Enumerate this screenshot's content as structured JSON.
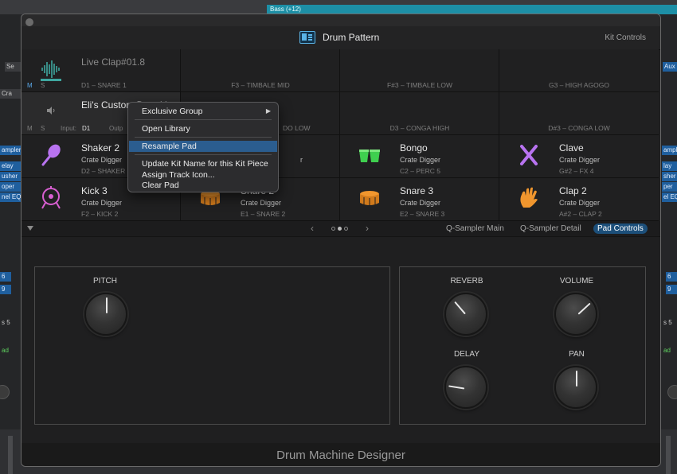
{
  "background": {
    "region_label": "Bass (+12)",
    "left_tags": [
      "Se",
      "Cra",
      "ampler",
      "elay",
      "usher",
      "oper",
      "nel EQ",
      "6",
      "9",
      "s 5",
      "ad"
    ],
    "right_tags": [
      "Aux",
      "ampler",
      "lay",
      "sher",
      "per",
      "el EQ",
      "6",
      "9",
      "s 5",
      "ad"
    ]
  },
  "header": {
    "title": "Drum Pattern",
    "right_label": "Kit Controls",
    "icon": "drum-pattern-icon"
  },
  "pads": [
    {
      "name": "Live Clap#01.8",
      "sub": "",
      "note": "D1 – SNARE 1",
      "icon": "waveform-icon",
      "ms": [
        "M",
        "S"
      ]
    },
    {
      "name": "",
      "sub": "",
      "note": "F3 – TIMBALE MID",
      "icon": ""
    },
    {
      "name": "",
      "sub": "",
      "note": "F#3 – TIMBALE LOW",
      "icon": ""
    },
    {
      "name": "",
      "sub": "",
      "note": "G3 – HIGH AGOGO",
      "icon": ""
    },
    {
      "name": "Eli's Custom Drumkit",
      "sub": "",
      "note": "",
      "icon": "speaker-icon",
      "ms": [
        "M",
        "S",
        "Input:",
        "D1",
        "Outp"
      ]
    },
    {
      "name": "",
      "sub": "",
      "note": "DO LOW",
      "icon": ""
    },
    {
      "name": "",
      "sub": "",
      "note": "D3 – CONGA HIGH",
      "icon": ""
    },
    {
      "name": "",
      "sub": "",
      "note": "D#3 – CONGA LOW",
      "icon": ""
    },
    {
      "name": "Shaker 2",
      "sub": "Crate Digger",
      "note": "D2 – SHAKER",
      "icon": "maraca-icon"
    },
    {
      "name": "",
      "sub": "r",
      "note": "",
      "icon": ""
    },
    {
      "name": "Bongo",
      "sub": "Crate Digger",
      "note": "C2 – PERC 5",
      "icon": "bongo-icon"
    },
    {
      "name": "Clave",
      "sub": "Crate Digger",
      "note": "G#2 – FX 4",
      "icon": "clave-icon"
    },
    {
      "name": "Kick 3",
      "sub": "Crate Digger",
      "note": "F2 – KICK 2",
      "icon": "kick-drum-icon"
    },
    {
      "name": "Snare 2",
      "sub": "Crate Digger",
      "note": "E1 – SNARE 2",
      "icon": "snare-drum-icon"
    },
    {
      "name": "Snare 3",
      "sub": "Crate Digger",
      "note": "E2 – SNARE 3",
      "icon": "snare-drum-icon"
    },
    {
      "name": "Clap 2",
      "sub": "Crate Digger",
      "note": "A#2 – CLAP 2",
      "icon": "clap-hand-icon"
    }
  ],
  "tabs": {
    "items": [
      "Q-Sampler Main",
      "Q-Sampler Detail",
      "Pad Controls"
    ],
    "active": "Pad Controls",
    "page_dots": 3,
    "active_dot": 2
  },
  "knobs": {
    "pitch": {
      "label": "PITCH",
      "value": 0
    },
    "reverb": {
      "label": "REVERB",
      "value": -0.3
    },
    "volume": {
      "label": "VOLUME",
      "value": 0.35
    },
    "delay": {
      "label": "DELAY",
      "value": -0.6
    },
    "pan": {
      "label": "PAN",
      "value": 0
    }
  },
  "footer": {
    "title": "Drum Machine Designer"
  },
  "context_menu": {
    "items": [
      {
        "label": "Exclusive Group",
        "submenu": true
      },
      {
        "label": "Open Library"
      },
      {
        "label": "Resample Pad",
        "highlighted": true
      },
      {
        "label": "Update Kit Name for this Kit Piece"
      },
      {
        "label": "Assign Track Icon..."
      },
      {
        "label": "Clear Pad"
      }
    ]
  },
  "colors": {
    "accent_blue": "#2b5d8f",
    "tab_active": "#1c4f7a",
    "icon_purple": "#b873f0",
    "icon_green": "#3fcf4f",
    "icon_orange": "#f0962e",
    "icon_teal": "#3fa7a0"
  }
}
